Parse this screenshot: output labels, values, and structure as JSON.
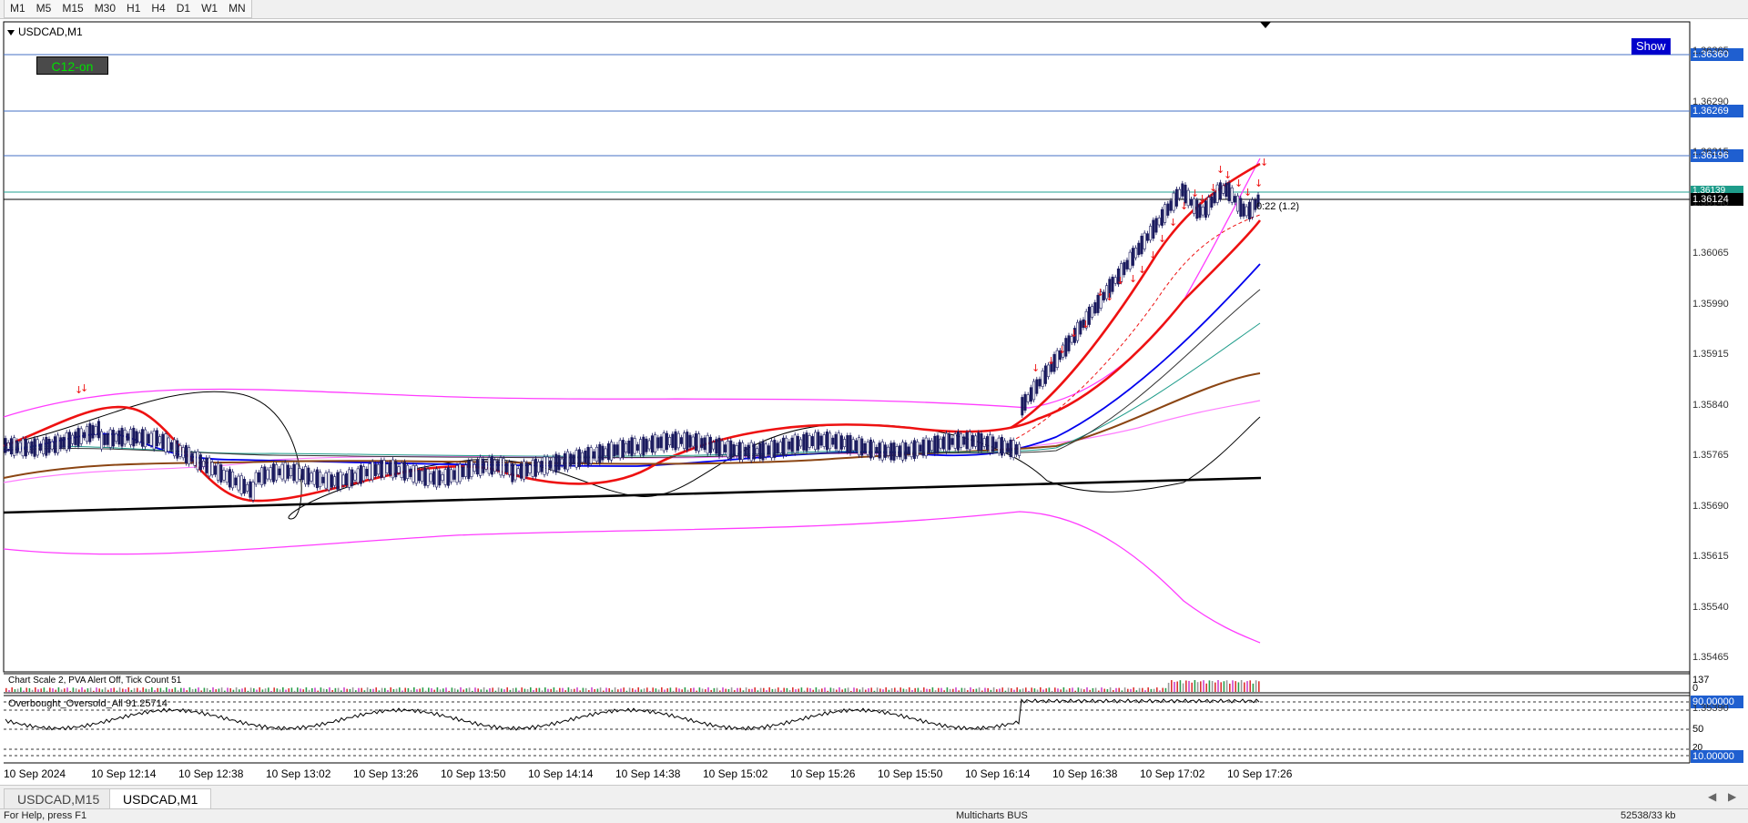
{
  "timeframes": [
    "M1",
    "M5",
    "M15",
    "M30",
    "H1",
    "H4",
    "D1",
    "W1",
    "MN"
  ],
  "chart": {
    "symbol": "USDCAD,M1",
    "c12_label": "C12-on",
    "show_label": "Show",
    "price_axis": [
      "1.36365",
      "1.36290",
      "1.36215",
      "1.36140",
      "1.36065",
      "1.35990",
      "1.35915",
      "1.35840",
      "1.35765",
      "1.35690",
      "1.35615",
      "1.35540",
      "1.35465",
      "1.35390"
    ],
    "price_tags": {
      "blue_1": "1.36360",
      "blue_2": "1.36269",
      "blue_3": "1.36196",
      "teal": "1.36139",
      "current": "1.36124"
    },
    "countdown": "0:22 (1.2)",
    "colors": {
      "blue_tag": "#1f5fd0",
      "teal_tag": "#1e9c8a",
      "current_tag": "#000000",
      "green_text": "#00e000"
    }
  },
  "volume_panel": {
    "label": "Chart Scale  2,   PVA Alert Off,   Tick Count  51",
    "axis_top": "137",
    "axis_zero": "0"
  },
  "oscillator": {
    "label": "Overbought_Oversold_All 91.25714",
    "level_high": "90.00000",
    "level_mid": "50",
    "level_20": "20",
    "level_low": "10.00000"
  },
  "time_axis": [
    "10 Sep 2024",
    "10 Sep 12:14",
    "10 Sep 12:38",
    "10 Sep 13:02",
    "10 Sep 13:26",
    "10 Sep 13:50",
    "10 Sep 14:14",
    "10 Sep 14:38",
    "10 Sep 15:02",
    "10 Sep 15:26",
    "10 Sep 15:50",
    "10 Sep 16:14",
    "10 Sep 16:38",
    "10 Sep 17:02",
    "10 Sep 17:26"
  ],
  "tabs": [
    {
      "label": "USDCAD,M15",
      "active": false
    },
    {
      "label": "USDCAD,M1",
      "active": true
    }
  ],
  "status": {
    "left": "For Help, press F1",
    "middle": "Multicharts BUS",
    "right": "52538/33 kb"
  }
}
